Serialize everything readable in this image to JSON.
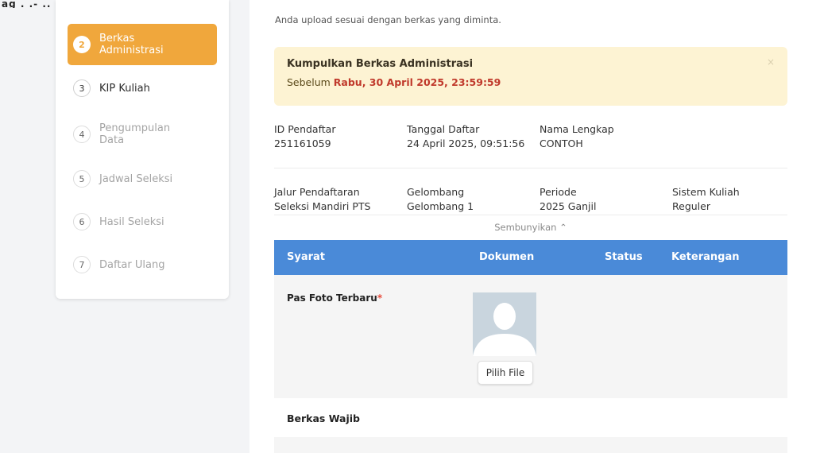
{
  "header_fragment": "ag . .- .. .. .. . . . .",
  "sidebar": {
    "steps": [
      {
        "number": "2",
        "label": "Berkas Administrasi",
        "state": "active"
      },
      {
        "number": "3",
        "label": "KIP Kuliah",
        "state": "done"
      },
      {
        "number": "4",
        "label": "Pengumpulan Data",
        "state": "pending"
      },
      {
        "number": "5",
        "label": "Jadwal Seleksi",
        "state": "pending"
      },
      {
        "number": "6",
        "label": "Hasil Seleksi",
        "state": "pending"
      },
      {
        "number": "7",
        "label": "Daftar Ulang",
        "state": "pending"
      }
    ]
  },
  "main": {
    "intro_text": "Anda upload sesuai dengan berkas yang diminta.",
    "alert": {
      "title": "Kumpulkan Berkas Administrasi",
      "prefix": "Sebelum ",
      "deadline": "Rabu, 30 April 2025, 23:59:59",
      "close_icon": "×"
    },
    "info_row1": [
      {
        "label": "ID Pendaftar",
        "value": "251161059"
      },
      {
        "label": "Tanggal Daftar",
        "value": "24 April 2025, 09:51:56"
      },
      {
        "label": "Nama Lengkap",
        "value": "CONTOH"
      }
    ],
    "info_row2": [
      {
        "label": "Jalur Pendaftaran",
        "value": "Seleksi Mandiri PTS"
      },
      {
        "label": "Gelombang",
        "value": "Gelombang 1"
      },
      {
        "label": "Periode",
        "value": "2025 Ganjil"
      },
      {
        "label": "Sistem Kuliah",
        "value": "Reguler"
      }
    ],
    "toggle_label": "Sembunyikan ⌃",
    "table": {
      "headers": [
        "Syarat",
        "Dokumen",
        "Status",
        "Keterangan"
      ],
      "rows": [
        {
          "syarat": "Pas Foto Terbaru",
          "required_mark": "*",
          "button": "Pilih File"
        }
      ]
    },
    "section_label": "Berkas Wajib"
  },
  "colors": {
    "accent_orange": "#f0a73c",
    "table_header_blue": "#4a8ad8",
    "alert_bg": "#fdf3d3",
    "deadline_red": "#c0392b"
  }
}
